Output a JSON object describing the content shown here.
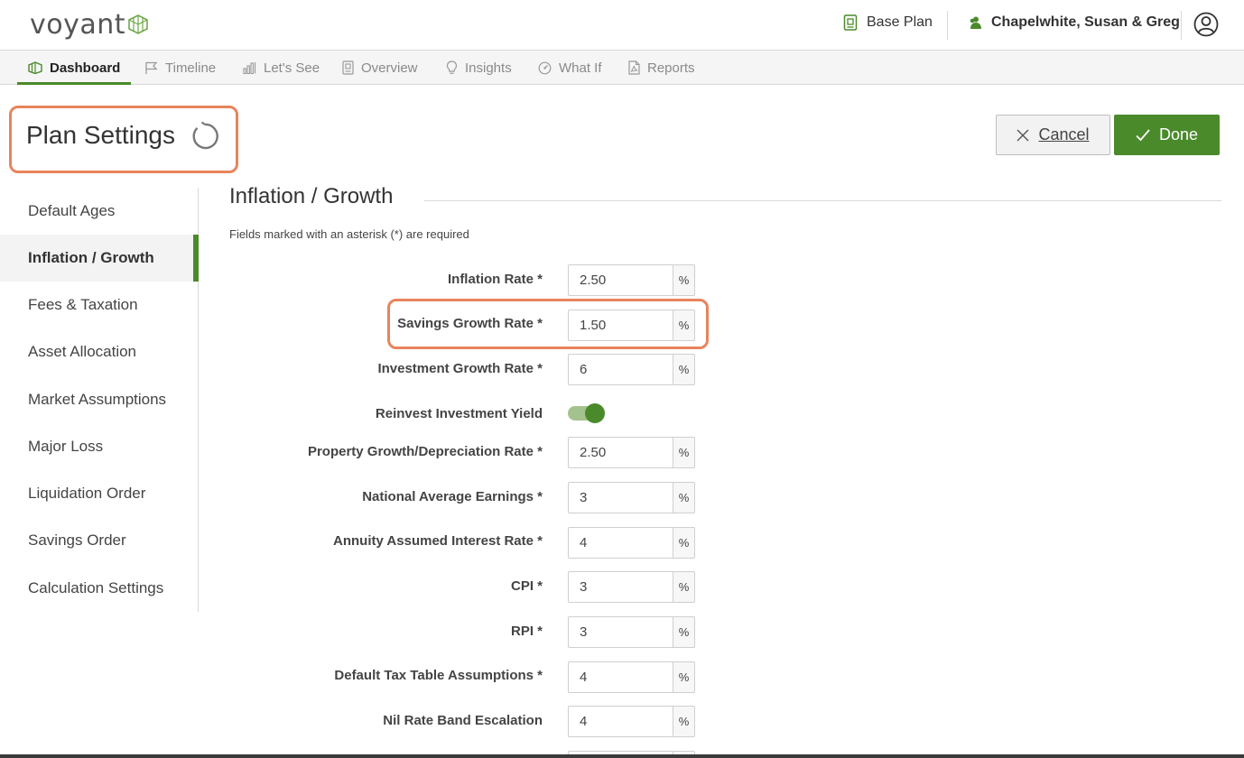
{
  "header": {
    "logo_text": "voyant",
    "plan_name": "Base Plan",
    "client_name": "Chapelwhite, Susan & Greg"
  },
  "nav": {
    "tabs": [
      {
        "label": "Dashboard",
        "icon": "dashboard-icon",
        "active": true
      },
      {
        "label": "Timeline",
        "icon": "flag-icon"
      },
      {
        "label": "Let's See",
        "icon": "bar-chart-icon"
      },
      {
        "label": "Overview",
        "icon": "document-icon"
      },
      {
        "label": "Insights",
        "icon": "lightbulb-icon"
      },
      {
        "label": "What If",
        "icon": "gauge-icon"
      },
      {
        "label": "Reports",
        "icon": "pdf-icon"
      }
    ]
  },
  "page": {
    "title": "Plan Settings",
    "cancel_label": "Cancel",
    "done_label": "Done"
  },
  "sidebar": {
    "items": [
      {
        "label": "Default Ages"
      },
      {
        "label": "Inflation / Growth",
        "active": true
      },
      {
        "label": "Fees & Taxation"
      },
      {
        "label": "Asset Allocation"
      },
      {
        "label": "Market Assumptions"
      },
      {
        "label": "Major Loss"
      },
      {
        "label": "Liquidation Order"
      },
      {
        "label": "Savings Order"
      },
      {
        "label": "Calculation Settings"
      }
    ]
  },
  "section": {
    "title": "Inflation / Growth",
    "required_note": "Fields marked with an asterisk (*) are required",
    "fields": [
      {
        "label": "Inflation Rate *",
        "value": "2.50",
        "unit": "%"
      },
      {
        "label": "Savings Growth Rate *",
        "value": "1.50",
        "unit": "%"
      },
      {
        "label": "Investment Growth Rate *",
        "value": "6",
        "unit": "%"
      },
      {
        "label": "Reinvest Investment Yield",
        "toggle_on": true
      },
      {
        "label": "Property Growth/Depreciation Rate *",
        "value": "2.50",
        "unit": "%"
      },
      {
        "label": "National Average Earnings *",
        "value": "3",
        "unit": "%"
      },
      {
        "label": "Annuity Assumed Interest Rate *",
        "value": "4",
        "unit": "%"
      },
      {
        "label": "CPI *",
        "value": "3",
        "unit": "%"
      },
      {
        "label": "RPI *",
        "value": "3",
        "unit": "%"
      },
      {
        "label": "Default Tax Table Assumptions *",
        "value": "4",
        "unit": "%"
      },
      {
        "label": "Nil Rate Band Escalation",
        "value": "4",
        "unit": "%"
      }
    ]
  },
  "colors": {
    "brand_green": "#4a8a2a",
    "highlight_orange": "#e8845c"
  }
}
